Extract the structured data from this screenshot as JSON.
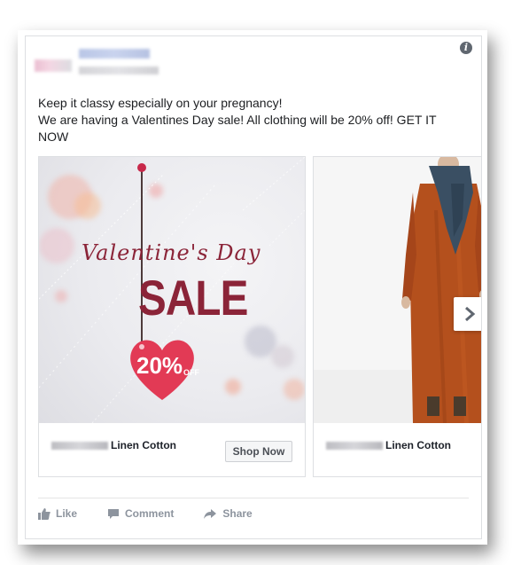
{
  "post": {
    "text_lines": [
      "Keep it classy especially on your pregnancy!",
      "We are having a Valentines Day sale! All clothing will be 20% off! GET IT",
      "NOW"
    ]
  },
  "cards": [
    {
      "image_texts": {
        "script": "Valentine's Day",
        "sale": "SALE",
        "percent": "20%",
        "off": "OFF"
      },
      "name": "Linen Cotton",
      "cta": "Shop Now"
    },
    {
      "name": "Linen Cotton"
    }
  ],
  "actions": {
    "like": "Like",
    "comment": "Comment",
    "share": "Share"
  },
  "icons": {
    "info": "info-icon",
    "next": "chevron-right-icon",
    "like": "thumbs-up-icon",
    "comment": "comment-icon",
    "share": "share-arrow-icon"
  },
  "colors": {
    "accent_red": "#8b2438",
    "heart_red": "#e23a55",
    "dress_orange": "#b4501d",
    "scarf_blue": "#3a4f63"
  }
}
